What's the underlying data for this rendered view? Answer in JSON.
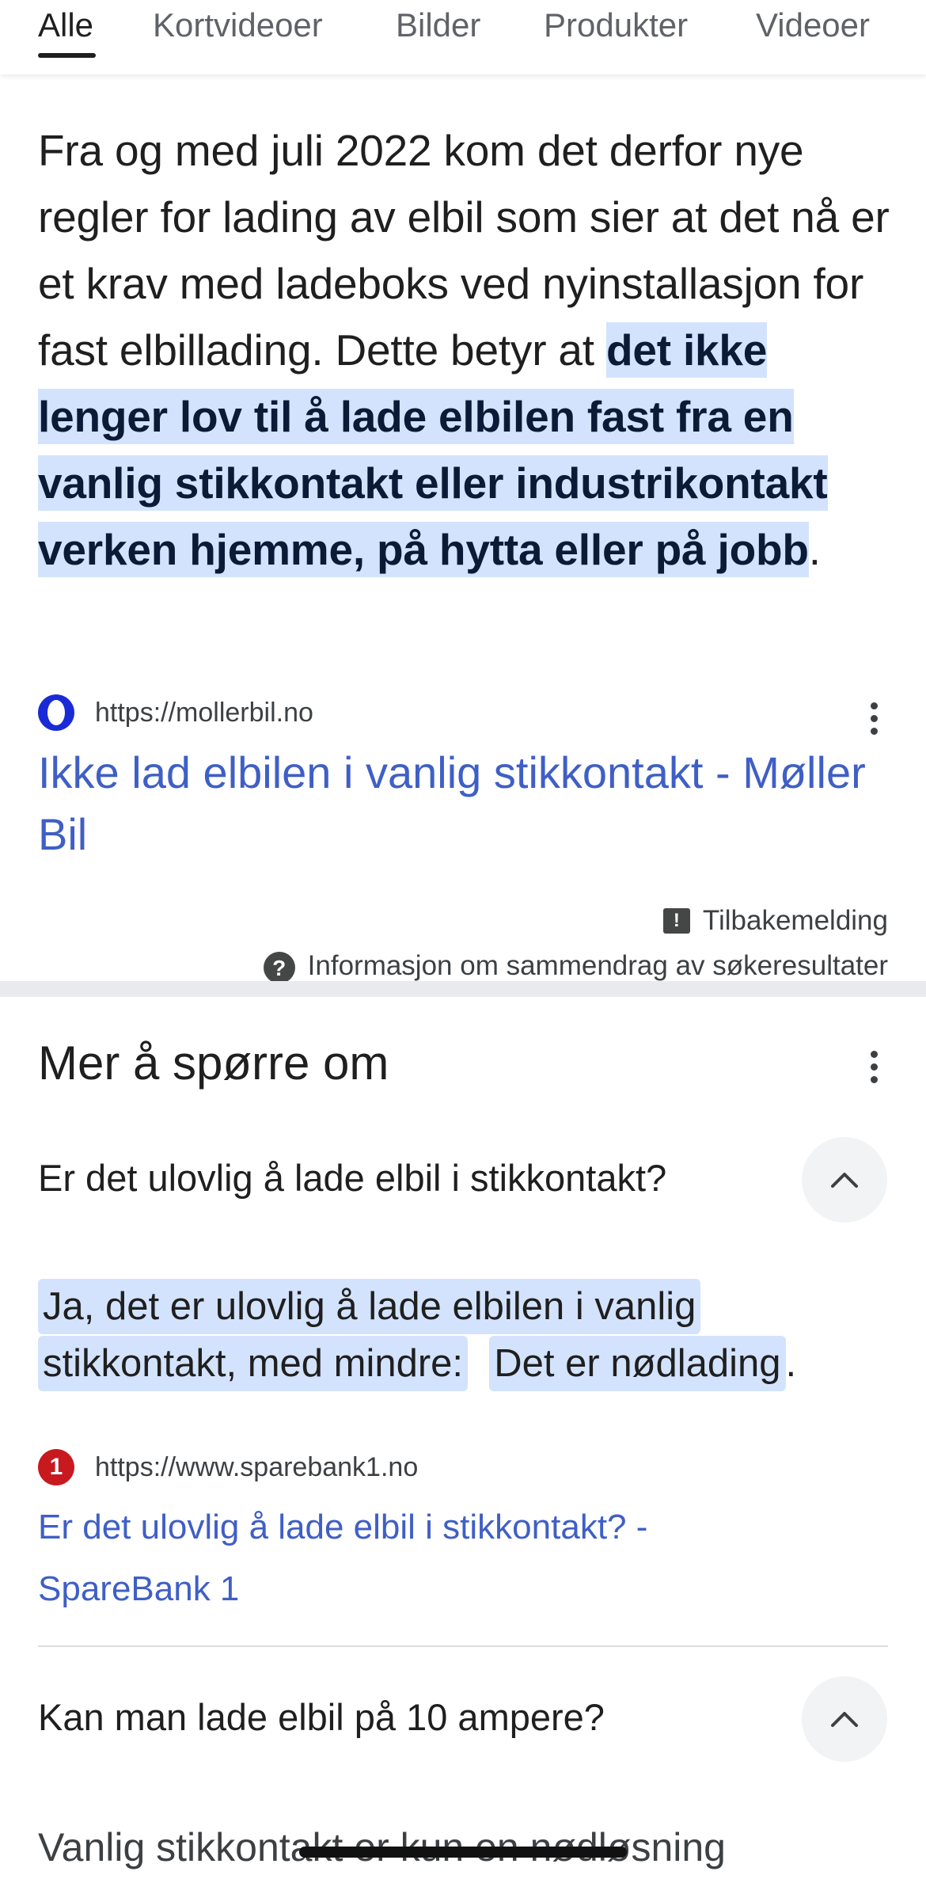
{
  "tabs": [
    {
      "label": "Alle",
      "active": true
    },
    {
      "label": "Kortvideoer"
    },
    {
      "label": "Bilder"
    },
    {
      "label": "Produkter"
    },
    {
      "label": "Videoer"
    }
  ],
  "overview": {
    "text_before": "Fra og med juli 2022 kom det derfor nye regler for lading av elbil som sier at det nå er et krav med ladeboks ved nyinstallasjon for fast elbillading. Dette betyr at ",
    "highlight": "det ikke lenger lov til å lade elbilen fast fra en vanlig stikkontakt eller industrikontakt verken hjemme, på hytta eller på jobb",
    "text_after": ".",
    "source": {
      "url": "https://mollerbil.no",
      "title": "Ikke lad elbilen i vanlig stikkontakt - Møller Bil"
    },
    "feedback_label": "Tilbakemelding",
    "info_label": "Informasjon om sammendrag av søkeresultater"
  },
  "paa": {
    "title": "Mer å spørre om",
    "questions": [
      {
        "question": "Er det ulovlig å lade elbil i stikkontakt?",
        "answer_highlight_1": "Ja, det er ulovlig å lade elbilen i vanlig stikkontakt, med mindre:",
        "answer_highlight_2": "Det er nødlading",
        "answer_tail": ".",
        "source_url": "https://www.sparebank1.no",
        "source_favicon_text": "1",
        "source_title": "Er det ulovlig å lade elbil i stikkontakt? - SpareBank 1"
      },
      {
        "question": "Kan man lade elbil på 10 ampere?",
        "answer_preview": "Vanlig stikkontakt er kun en nødløsning"
      }
    ]
  },
  "icons": {
    "menu": "more-vert-icon",
    "feedback": "feedback-icon",
    "info": "help-icon",
    "chevron": "chevron-up-icon"
  }
}
